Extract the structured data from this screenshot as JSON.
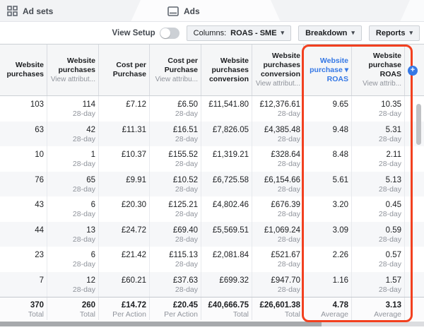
{
  "tab_bar": {
    "tabs": [
      {
        "label": "Ad sets"
      },
      {
        "label": "Ads"
      }
    ]
  },
  "toolbar": {
    "view_setup_label": "View Setup",
    "columns_prefix": "Columns:",
    "columns_value": "ROAS - SME",
    "breakdown_label": "Breakdown",
    "reports_label": "Reports",
    "caret": "▾"
  },
  "table": {
    "columns": [
      {
        "title": "Website purchases",
        "subtitle": "",
        "sorted": false
      },
      {
        "title": "Website purchases",
        "subtitle": "View attribut...",
        "sorted": false
      },
      {
        "title": "Cost per Purchase",
        "subtitle": "",
        "sorted": false
      },
      {
        "title": "Cost per Purchase",
        "subtitle": "View attribu...",
        "sorted": false
      },
      {
        "title": "Website purchases conversion",
        "subtitle": "",
        "sorted": false
      },
      {
        "title": "Website purchases conversion",
        "subtitle": "View attribut...",
        "sorted": false
      },
      {
        "title": "Website purchase ▾ ROAS",
        "subtitle": "",
        "sorted": true
      },
      {
        "title": "Website purchase ROAS",
        "subtitle": "View attrib...",
        "sorted": false
      }
    ],
    "rows": [
      [
        [
          "103",
          ""
        ],
        [
          "114",
          "28-day"
        ],
        [
          "£7.12",
          ""
        ],
        [
          "£6.50",
          "28-day"
        ],
        [
          "£11,541.80",
          ""
        ],
        [
          "£12,376.61",
          "28-day"
        ],
        [
          "9.65",
          ""
        ],
        [
          "10.35",
          "28-day"
        ]
      ],
      [
        [
          "63",
          ""
        ],
        [
          "42",
          "28-day"
        ],
        [
          "£11.31",
          ""
        ],
        [
          "£16.51",
          "28-day"
        ],
        [
          "£7,826.05",
          ""
        ],
        [
          "£4,385.48",
          "28-day"
        ],
        [
          "9.48",
          ""
        ],
        [
          "5.31",
          "28-day"
        ]
      ],
      [
        [
          "10",
          ""
        ],
        [
          "1",
          "28-day"
        ],
        [
          "£10.37",
          ""
        ],
        [
          "£155.52",
          "28-day"
        ],
        [
          "£1,319.21",
          ""
        ],
        [
          "£328.64",
          "28-day"
        ],
        [
          "8.48",
          ""
        ],
        [
          "2.11",
          "28-day"
        ]
      ],
      [
        [
          "76",
          ""
        ],
        [
          "65",
          "28-day"
        ],
        [
          "£9.91",
          ""
        ],
        [
          "£10.52",
          "28-day"
        ],
        [
          "£6,725.58",
          ""
        ],
        [
          "£6,154.66",
          "28-day"
        ],
        [
          "5.61",
          ""
        ],
        [
          "5.13",
          "28-day"
        ]
      ],
      [
        [
          "43",
          ""
        ],
        [
          "6",
          "28-day"
        ],
        [
          "£20.30",
          ""
        ],
        [
          "£125.21",
          "28-day"
        ],
        [
          "£4,802.46",
          ""
        ],
        [
          "£676.39",
          "28-day"
        ],
        [
          "3.20",
          ""
        ],
        [
          "0.45",
          "28-day"
        ]
      ],
      [
        [
          "44",
          ""
        ],
        [
          "13",
          "28-day"
        ],
        [
          "£24.72",
          ""
        ],
        [
          "£69.40",
          "28-day"
        ],
        [
          "£5,569.51",
          ""
        ],
        [
          "£1,069.24",
          "28-day"
        ],
        [
          "3.09",
          ""
        ],
        [
          "0.59",
          "28-day"
        ]
      ],
      [
        [
          "23",
          ""
        ],
        [
          "6",
          "28-day"
        ],
        [
          "£21.42",
          ""
        ],
        [
          "£115.13",
          "28-day"
        ],
        [
          "£2,081.84",
          ""
        ],
        [
          "£521.67",
          "28-day"
        ],
        [
          "2.26",
          ""
        ],
        [
          "0.57",
          "28-day"
        ]
      ],
      [
        [
          "7",
          ""
        ],
        [
          "12",
          "28-day"
        ],
        [
          "£60.21",
          ""
        ],
        [
          "£37.63",
          "28-day"
        ],
        [
          "£699.32",
          ""
        ],
        [
          "£947.70",
          "28-day"
        ],
        [
          "1.16",
          ""
        ],
        [
          "1.57",
          "28-day"
        ]
      ]
    ],
    "totals": [
      [
        "370",
        "Total"
      ],
      [
        "260",
        "Total"
      ],
      [
        "£14.72",
        "Per Action"
      ],
      [
        "£20.45",
        "Per Action"
      ],
      [
        "£40,666.75",
        "Total"
      ],
      [
        "£26,601.38",
        "Total"
      ],
      [
        "4.78",
        "Average"
      ],
      [
        "3.13",
        "Average"
      ]
    ]
  },
  "add_column_button": {
    "glyph": "+"
  },
  "colors": {
    "accent_blue": "#3578e5",
    "highlight_red": "#f2401f"
  }
}
